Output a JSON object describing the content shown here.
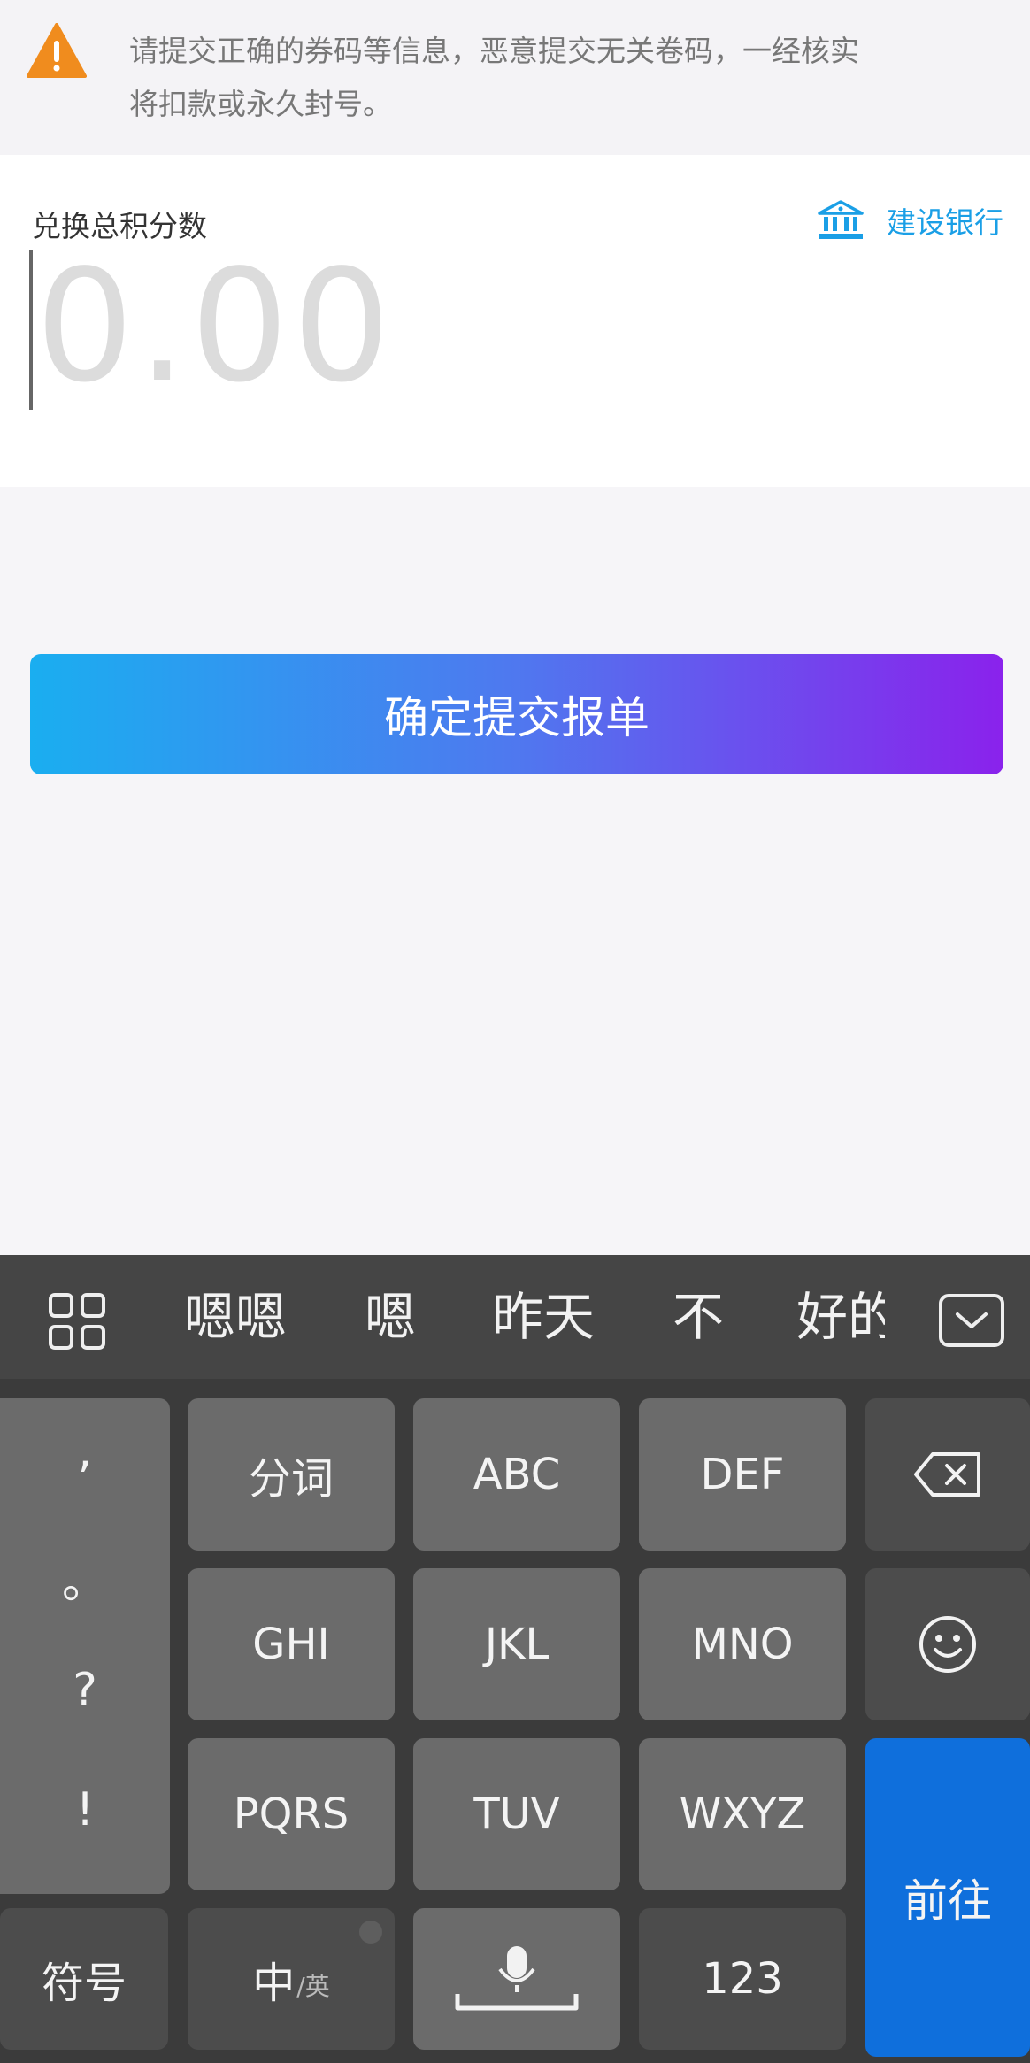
{
  "notice": {
    "icon": "warning-triangle-icon",
    "icon_color": "#f08c1e",
    "line1": "请提交正确的券码等信息，恶意提交无关卷码，一经核实",
    "line2": "将扣款或永久封号。"
  },
  "points": {
    "label": "兑换总积分数",
    "placeholder": "0.00",
    "bank_icon": "bank-icon",
    "bank_name": "建设银行",
    "bank_color": "#1a9fe6"
  },
  "submit": {
    "label": "确定提交报单",
    "gradient": [
      "#1aaef0",
      "#8a22ec"
    ]
  },
  "keyboard": {
    "candidates": [
      "嗯嗯",
      "嗯",
      "昨天",
      "不",
      "好的"
    ],
    "punctuation": [
      ",",
      "。",
      "?",
      "!"
    ],
    "keys": {
      "fenci": "分词",
      "abc": "ABC",
      "def": "DEF",
      "ghi": "GHI",
      "jkl": "JKL",
      "mno": "MNO",
      "pqrs": "PQRS",
      "tuv": "TUV",
      "wxyz": "WXYZ",
      "symbols": "符号",
      "zh": "中",
      "en": "/英",
      "num": "123",
      "go": "前往"
    },
    "go_color": "#0f6fdc"
  }
}
